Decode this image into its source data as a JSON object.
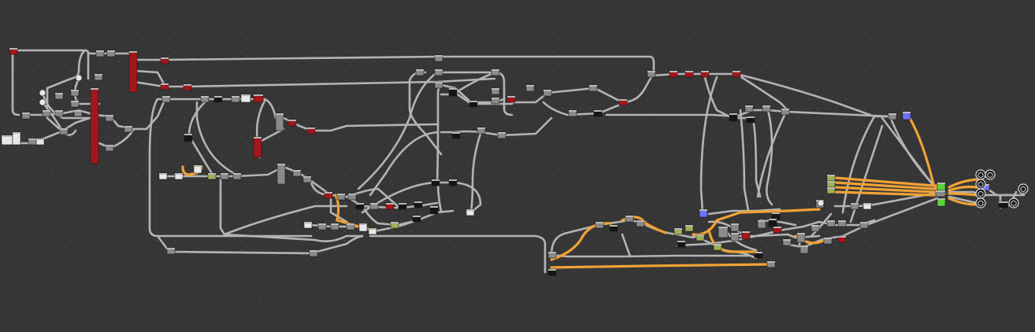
{
  "app": {
    "view": "material-node-graph"
  },
  "colors": {
    "background": "#363636",
    "wire": "#b4b4b4",
    "wire_active": "#f0a236",
    "node_header": "#b8b8b8",
    "node_red": "#a5161c",
    "node_green": "#5bd43a",
    "node_blue": "#6d6fff",
    "node_light": "#e8e8e8",
    "node_dark": "#151515",
    "node_gray": "#8a8a8a",
    "node_olive": "#9db356"
  },
  "graph": {
    "node_kinds": [
      "red-block",
      "gray-block",
      "dark-block",
      "light-block",
      "green-output",
      "blue-input",
      "output-socket",
      "reroute-dot"
    ],
    "output_sockets": 6
  }
}
